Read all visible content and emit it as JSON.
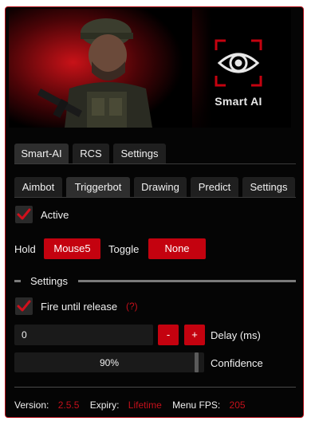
{
  "brand": {
    "name": "Smart AI",
    "accent": "#c4020f",
    "border": "#b5121b"
  },
  "main_tabs": [
    {
      "label": "Smart-AI",
      "active": true
    },
    {
      "label": "RCS",
      "active": false
    },
    {
      "label": "Settings",
      "active": false
    }
  ],
  "sub_tabs": [
    {
      "label": "Aimbot",
      "active": false
    },
    {
      "label": "Triggerbot",
      "active": true
    },
    {
      "label": "Drawing",
      "active": false
    },
    {
      "label": "Predict",
      "active": false
    },
    {
      "label": "Settings",
      "active": false
    }
  ],
  "active_option": {
    "label": "Active",
    "checked": true
  },
  "keybinds": {
    "hold_label": "Hold",
    "hold_value": "Mouse5",
    "toggle_label": "Toggle",
    "toggle_value": "None"
  },
  "settings_section": {
    "title": "Settings",
    "fire_until_release": {
      "label": "Fire until release",
      "hint": "(?)",
      "checked": true
    },
    "delay": {
      "value": "0",
      "minus": "-",
      "plus": "+",
      "label": "Delay (ms)"
    },
    "confidence": {
      "value_text": "90%",
      "fraction": 0.9,
      "label": "Confidence"
    }
  },
  "footer": {
    "version_label": "Version:",
    "version_value": "2.5.5",
    "expiry_label": "Expiry:",
    "expiry_value": "Lifetime",
    "fps_label": "Menu FPS:",
    "fps_value": "205"
  }
}
